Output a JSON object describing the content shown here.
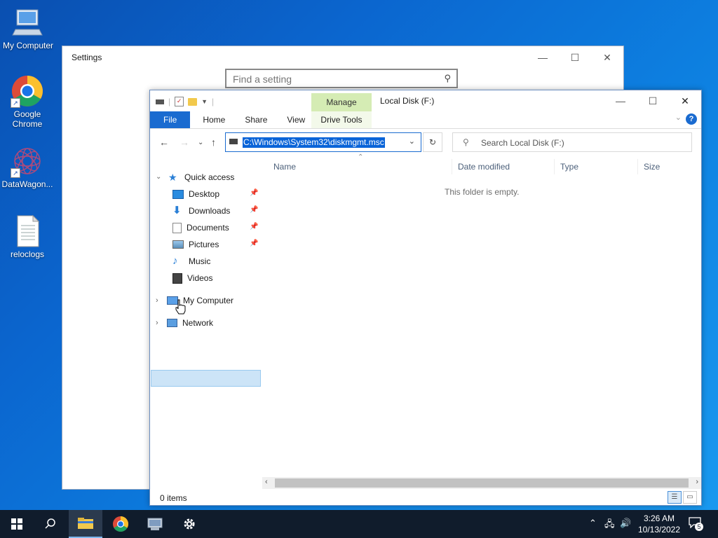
{
  "desktop": {
    "icons": [
      {
        "label": "My Computer"
      },
      {
        "label": "Google Chrome"
      },
      {
        "label": "DataWagon..."
      },
      {
        "label": "reloclogs"
      }
    ]
  },
  "settings": {
    "title": "Settings",
    "search_placeholder": "Find a setting"
  },
  "explorer": {
    "title": "Local Disk (F:)",
    "contextual_tab_group": "Manage",
    "contextual_tab": "Drive Tools",
    "ribbon_tabs": [
      "File",
      "Home",
      "Share",
      "View"
    ],
    "address_path": "C:\\Windows\\System32\\diskmgmt.msc",
    "search_placeholder": "Search Local Disk (F:)",
    "columns": [
      "Name",
      "Date modified",
      "Type",
      "Size"
    ],
    "empty_message": "This folder is empty.",
    "nav": {
      "quick_access": "Quick access",
      "items": [
        "Desktop",
        "Downloads",
        "Documents",
        "Pictures",
        "Music",
        "Videos"
      ],
      "my_computer": "My Computer",
      "network": "Network"
    },
    "status": "0 items"
  },
  "taskbar": {
    "time": "3:26 AM",
    "date": "10/13/2022",
    "notification_count": "5"
  },
  "colors": {
    "accent": "#1a6bd0",
    "manage_tab": "#d5ecb4",
    "selection": "#cce4f7",
    "taskbar": "#101c2c"
  }
}
